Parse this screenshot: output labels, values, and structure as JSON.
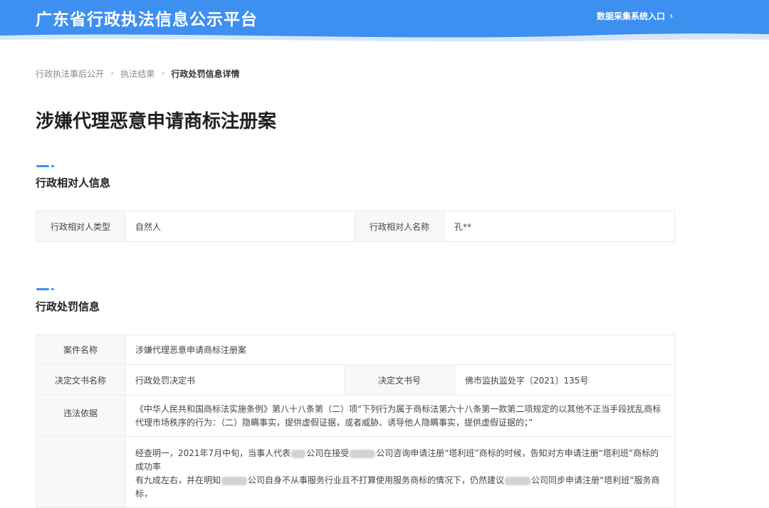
{
  "header": {
    "site_title": "广东省行政执法信息公示平台",
    "entry_label": "数据采集系统入口",
    "entry_icon": "chevron-right-icon",
    "background_color": "#3d8ff0"
  },
  "breadcrumb": {
    "items": [
      "行政执法事后公开",
      "执法结果"
    ],
    "current": "行政处罚信息详情"
  },
  "page_title": "涉嫌代理恶意申请商标注册案",
  "party_section": {
    "title": "行政相对人信息",
    "type_label": "行政相对人类型",
    "type_value": "自然人",
    "name_label": "行政相对人名称",
    "name_value": "孔**"
  },
  "penalty_section": {
    "title": "行政处罚信息",
    "case_name_label": "案件名称",
    "case_name_value": "涉嫌代理恶意申请商标注册案",
    "doc_name_label": "决定文书名称",
    "doc_name_value": "行政处罚决定书",
    "doc_no_label": "决定文书号",
    "doc_no_value": "佛市监执监处字〔2021〕135号",
    "basis_label": "违法依据",
    "basis_value": "《中华人民共和国商标法实施条例》第八十八条第（二）项“下列行为属于商标法第六十八条第一款第二项规定的以其他不正当手段扰乱商标代理市场秩序的行为：（二）隐瞒事实，提供虚假证据，或者威胁、诱导他人隐瞒事实，提供虚假证据的；”",
    "facts_line1_a": "经查明一，2021年7月中旬，当事人代表",
    "facts_line1_b": "公司在接受",
    "facts_line1_c": "公司咨询申请注册“塔利班”商标的时候，告知对方申请注册“塔利班”商标的成功率",
    "facts_line2_a": "有九成左右，并在明知",
    "facts_line2_b": "公司自身不从事服务行业且不打算使用服务商标的情况下，仍然建议",
    "facts_line2_c": "公司同步申请注册“塔利班”服务商标，"
  }
}
